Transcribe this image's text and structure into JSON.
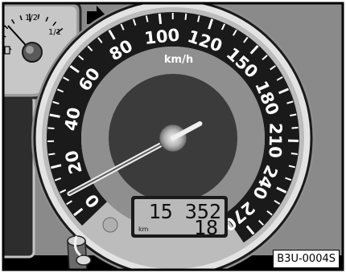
{
  "speedometer": {
    "unit": "km/h",
    "scale_labels": [
      "0",
      "20",
      "40",
      "60",
      "80",
      "100",
      "120",
      "150",
      "180",
      "210",
      "240",
      "270"
    ],
    "needle_speed": 8
  },
  "fuel_gauge": {
    "labels": [
      "1/2",
      "1/1"
    ]
  },
  "odometer": {
    "total_km": "15 352",
    "unit": "km",
    "trip_km": "18"
  },
  "image_code": "B3U-0004S",
  "icons": [
    "turn-signal-arrow-icon",
    "fuel-pump-icon",
    "reset-button-icon"
  ]
}
